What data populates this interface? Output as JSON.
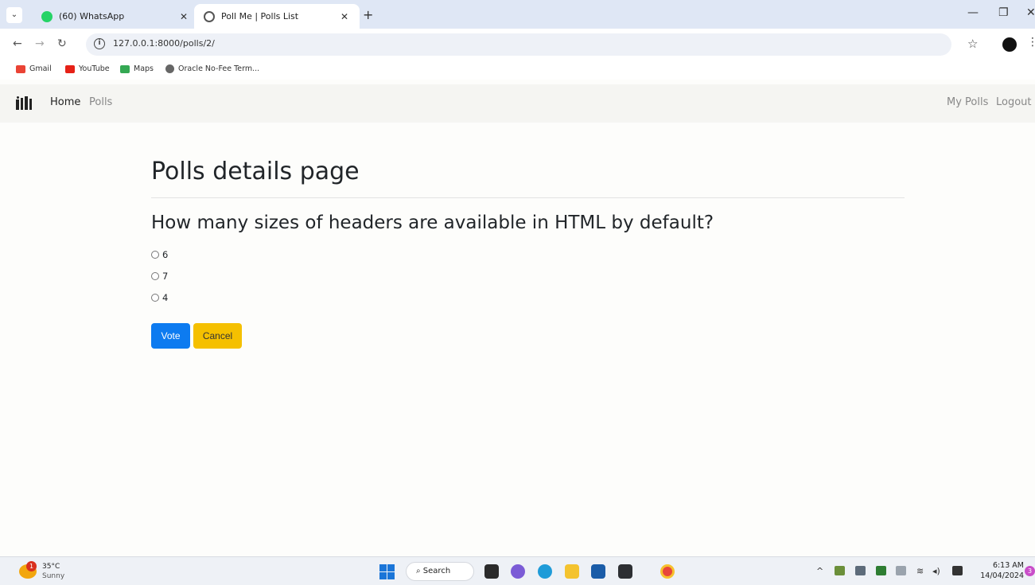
{
  "browser": {
    "tabs": [
      {
        "title": "(60) WhatsApp",
        "favicon": "whatsapp-icon",
        "active": false
      },
      {
        "title": "Poll Me | Polls List",
        "favicon": "globe-icon",
        "active": true
      }
    ],
    "url": "127.0.0.1:8000/polls/2/",
    "bookmarks": [
      {
        "label": "Gmail",
        "icon": "gmail-icon"
      },
      {
        "label": "YouTube",
        "icon": "youtube-icon"
      },
      {
        "label": "Maps",
        "icon": "maps-icon"
      },
      {
        "label": "Oracle No-Fee Term...",
        "icon": "globe-icon"
      }
    ]
  },
  "navbar": {
    "home": "Home",
    "polls": "Polls",
    "my_polls": "My Polls",
    "logout": "Logout"
  },
  "page": {
    "title": "Polls details page",
    "question": "How many sizes of headers are available in HTML by default?",
    "choices": [
      "6",
      "7",
      "4"
    ],
    "vote_label": "Vote",
    "cancel_label": "Cancel"
  },
  "taskbar": {
    "weather_temp": "35°C",
    "weather_cond": "Sunny",
    "weather_badge": "1",
    "search_label": "Search",
    "time": "6:13 AM",
    "date": "14/04/2024",
    "notifications": "3"
  },
  "colors": {
    "primary": "#0d7bf0",
    "warning": "#f5c000",
    "navbar_bg": "#f5f5f2",
    "page_bg": "#fdfdfb"
  }
}
